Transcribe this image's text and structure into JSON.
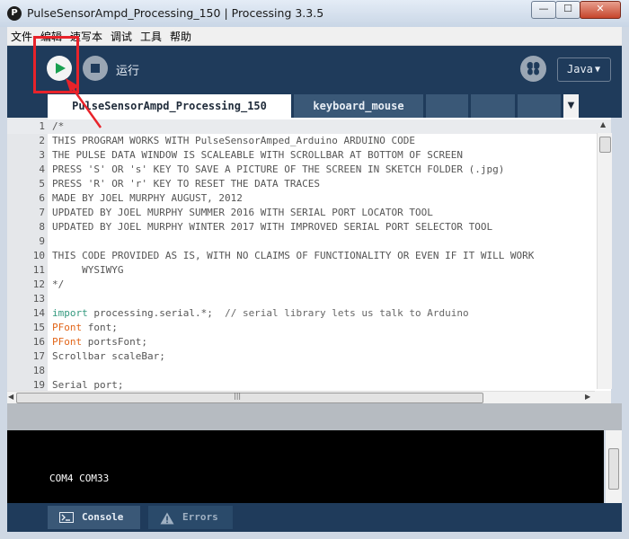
{
  "window": {
    "title": "PulseSensorAmpd_Processing_150 | Processing 3.3.5",
    "app_icon": "P",
    "min_glyph": "—",
    "max_glyph": "☐",
    "close_glyph": "✕"
  },
  "menu": [
    "文件",
    "编辑",
    "速写本",
    "调试",
    "工具",
    "帮助"
  ],
  "toolbar": {
    "run_tooltip_label": "运行",
    "mode": "Java",
    "mode_arrow": "▼"
  },
  "tabs": {
    "active": "PulseSensorAmpd_Processing_150",
    "second": "keyboard_mouse",
    "menu_arrow": "▼"
  },
  "editor": {
    "current_line": 1,
    "lines": [
      {
        "n": "1",
        "t": "/*"
      },
      {
        "n": "2",
        "t": "THIS PROGRAM WORKS WITH PulseSensorAmped_Arduino ARDUINO CODE"
      },
      {
        "n": "3",
        "t": "THE PULSE DATA WINDOW IS SCALEABLE WITH SCROLLBAR AT BOTTOM OF SCREEN"
      },
      {
        "n": "4",
        "t": "PRESS 'S' OR 's' KEY TO SAVE A PICTURE OF THE SCREEN IN SKETCH FOLDER (.jpg)"
      },
      {
        "n": "5",
        "t": "PRESS 'R' OR 'r' KEY TO RESET THE DATA TRACES"
      },
      {
        "n": "6",
        "t": "MADE BY JOEL MURPHY AUGUST, 2012"
      },
      {
        "n": "7",
        "t": "UPDATED BY JOEL MURPHY SUMMER 2016 WITH SERIAL PORT LOCATOR TOOL"
      },
      {
        "n": "8",
        "t": "UPDATED BY JOEL MURPHY WINTER 2017 WITH IMPROVED SERIAL PORT SELECTOR TOOL"
      },
      {
        "n": "9",
        "t": ""
      },
      {
        "n": "10",
        "t": "THIS CODE PROVIDED AS IS, WITH NO CLAIMS OF FUNCTIONALITY OR EVEN IF IT WILL WORK"
      },
      {
        "n": "11",
        "t": "     WYSIWYG"
      },
      {
        "n": "12",
        "t": "*/"
      },
      {
        "n": "13",
        "t": ""
      },
      {
        "n": "14",
        "kw": "import",
        "t": " processing.serial.*;",
        "c": "  // serial library lets us talk to Arduino"
      },
      {
        "n": "15",
        "ty": "PFont",
        "t": " font;"
      },
      {
        "n": "16",
        "ty": "PFont",
        "t": " portsFont;"
      },
      {
        "n": "17",
        "t": "Scrollbar scaleBar;"
      },
      {
        "n": "18",
        "t": ""
      },
      {
        "n": "19",
        "t": "Serial port;"
      }
    ]
  },
  "console": {
    "output": "COM4 COM33"
  },
  "footer": {
    "console_label": "Console",
    "errors_label": "Errors"
  },
  "annotation": {
    "color": "#e8232a"
  },
  "colors": {
    "toolbar_bg": "#1f3b5b",
    "run_green": "#1aa050",
    "keyword": "#33997e",
    "type": "#e2661a"
  }
}
